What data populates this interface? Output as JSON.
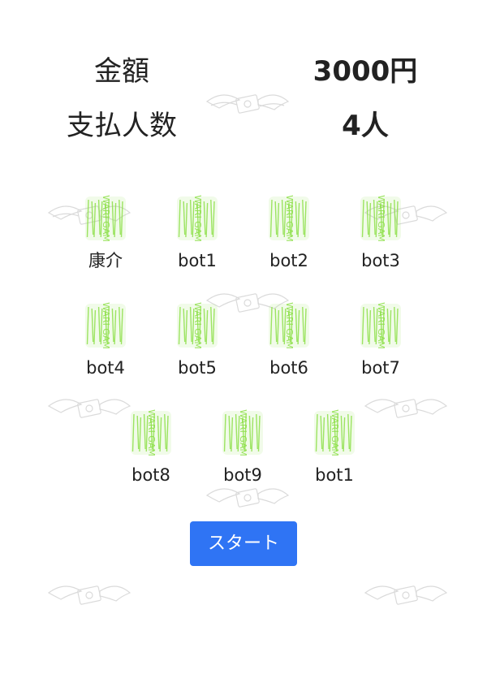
{
  "summary": {
    "amount_label": "金額",
    "amount_value": "3000円",
    "payers_label": "支払人数",
    "payers_value": "4人"
  },
  "players": [
    {
      "name": "康介",
      "icon": "wari-gam-logo-icon"
    },
    {
      "name": "bot1",
      "icon": "wari-gam-logo-icon"
    },
    {
      "name": "bot2",
      "icon": "wari-gam-logo-icon"
    },
    {
      "name": "bot3",
      "icon": "wari-gam-logo-icon"
    },
    {
      "name": "bot4",
      "icon": "wari-gam-logo-icon"
    },
    {
      "name": "bot5",
      "icon": "wari-gam-logo-icon"
    },
    {
      "name": "bot6",
      "icon": "wari-gam-logo-icon"
    },
    {
      "name": "bot7",
      "icon": "wari-gam-logo-icon"
    },
    {
      "name": "bot8",
      "icon": "wari-gam-logo-icon"
    },
    {
      "name": "bot9",
      "icon": "wari-gam-logo-icon"
    },
    {
      "name": "bot1",
      "icon": "wari-gam-logo-icon"
    }
  ],
  "start_button": {
    "label": "スタート"
  },
  "logo_text": "WARI GAM",
  "colors": {
    "accent": "#2f74f4",
    "logo_green": "#8ee04a",
    "text": "#222222",
    "watermark": "#cccccc"
  }
}
